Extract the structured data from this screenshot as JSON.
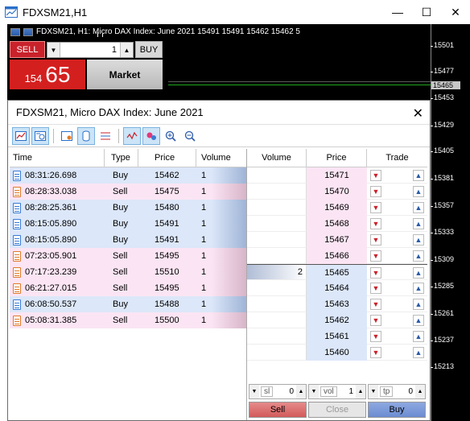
{
  "window": {
    "title": "FDXSM21,H1",
    "minimize": "—",
    "maximize": "☐",
    "close": "✕"
  },
  "chart": {
    "info": "FDXSM21, H1:  Micro DAX Index: June 2021   15491 15491 15462 15462  5",
    "price_ticks": [
      "15501",
      "15477",
      "15453",
      "15429",
      "15405",
      "15381",
      "15357",
      "15333",
      "15309",
      "15285",
      "15261",
      "15237",
      "15213"
    ],
    "current_price": "15465"
  },
  "one_click": {
    "sell_label": "SELL",
    "buy_label": "BUY",
    "lot": "1",
    "sell_small": "154",
    "sell_big": "65",
    "market_label": "Market"
  },
  "dom": {
    "title": "FDXSM21, Micro DAX Index: June 2021",
    "close": "✕",
    "trades_headers": [
      "Time",
      "Type",
      "Price",
      "Volume"
    ],
    "trades": [
      {
        "time": "08:31:26.698",
        "type": "Buy",
        "price": "15462",
        "volume": "1"
      },
      {
        "time": "08:28:33.038",
        "type": "Sell",
        "price": "15475",
        "volume": "1"
      },
      {
        "time": "08:28:25.361",
        "type": "Buy",
        "price": "15480",
        "volume": "1"
      },
      {
        "time": "08:15:05.890",
        "type": "Buy",
        "price": "15491",
        "volume": "1"
      },
      {
        "time": "08:15:05.890",
        "type": "Buy",
        "price": "15491",
        "volume": "1"
      },
      {
        "time": "07:23:05.901",
        "type": "Sell",
        "price": "15495",
        "volume": "1"
      },
      {
        "time": "07:17:23.239",
        "type": "Sell",
        "price": "15510",
        "volume": "1"
      },
      {
        "time": "06:21:27.015",
        "type": "Sell",
        "price": "15495",
        "volume": "1"
      },
      {
        "time": "06:08:50.537",
        "type": "Buy",
        "price": "15488",
        "volume": "1"
      },
      {
        "time": "05:08:31.385",
        "type": "Sell",
        "price": "15500",
        "volume": "1"
      }
    ],
    "book_headers": [
      "Volume",
      "Price",
      "Trade"
    ],
    "book": [
      {
        "volume": "",
        "price": "15471",
        "side": "ask"
      },
      {
        "volume": "",
        "price": "15470",
        "side": "ask"
      },
      {
        "volume": "",
        "price": "15469",
        "side": "ask"
      },
      {
        "volume": "",
        "price": "15468",
        "side": "ask"
      },
      {
        "volume": "",
        "price": "15467",
        "side": "ask"
      },
      {
        "volume": "",
        "price": "15466",
        "side": "ask"
      },
      {
        "volume": "2",
        "price": "15465",
        "side": "bid"
      },
      {
        "volume": "",
        "price": "15464",
        "side": "bid"
      },
      {
        "volume": "",
        "price": "15463",
        "side": "bid"
      },
      {
        "volume": "",
        "price": "15462",
        "side": "bid"
      },
      {
        "volume": "",
        "price": "15461",
        "side": "bid"
      },
      {
        "volume": "",
        "price": "15460",
        "side": "bid"
      }
    ],
    "sl_label": "sl",
    "sl_value": "0",
    "vol_label": "vol",
    "vol_value": "1",
    "tp_label": "tp",
    "tp_value": "0",
    "sell_btn": "Sell",
    "close_btn": "Close",
    "buy_btn": "Buy"
  },
  "colors": {
    "buy_row": "#dce7f9",
    "sell_row": "#fbe5f4",
    "sell_red": "#d41f1f"
  }
}
